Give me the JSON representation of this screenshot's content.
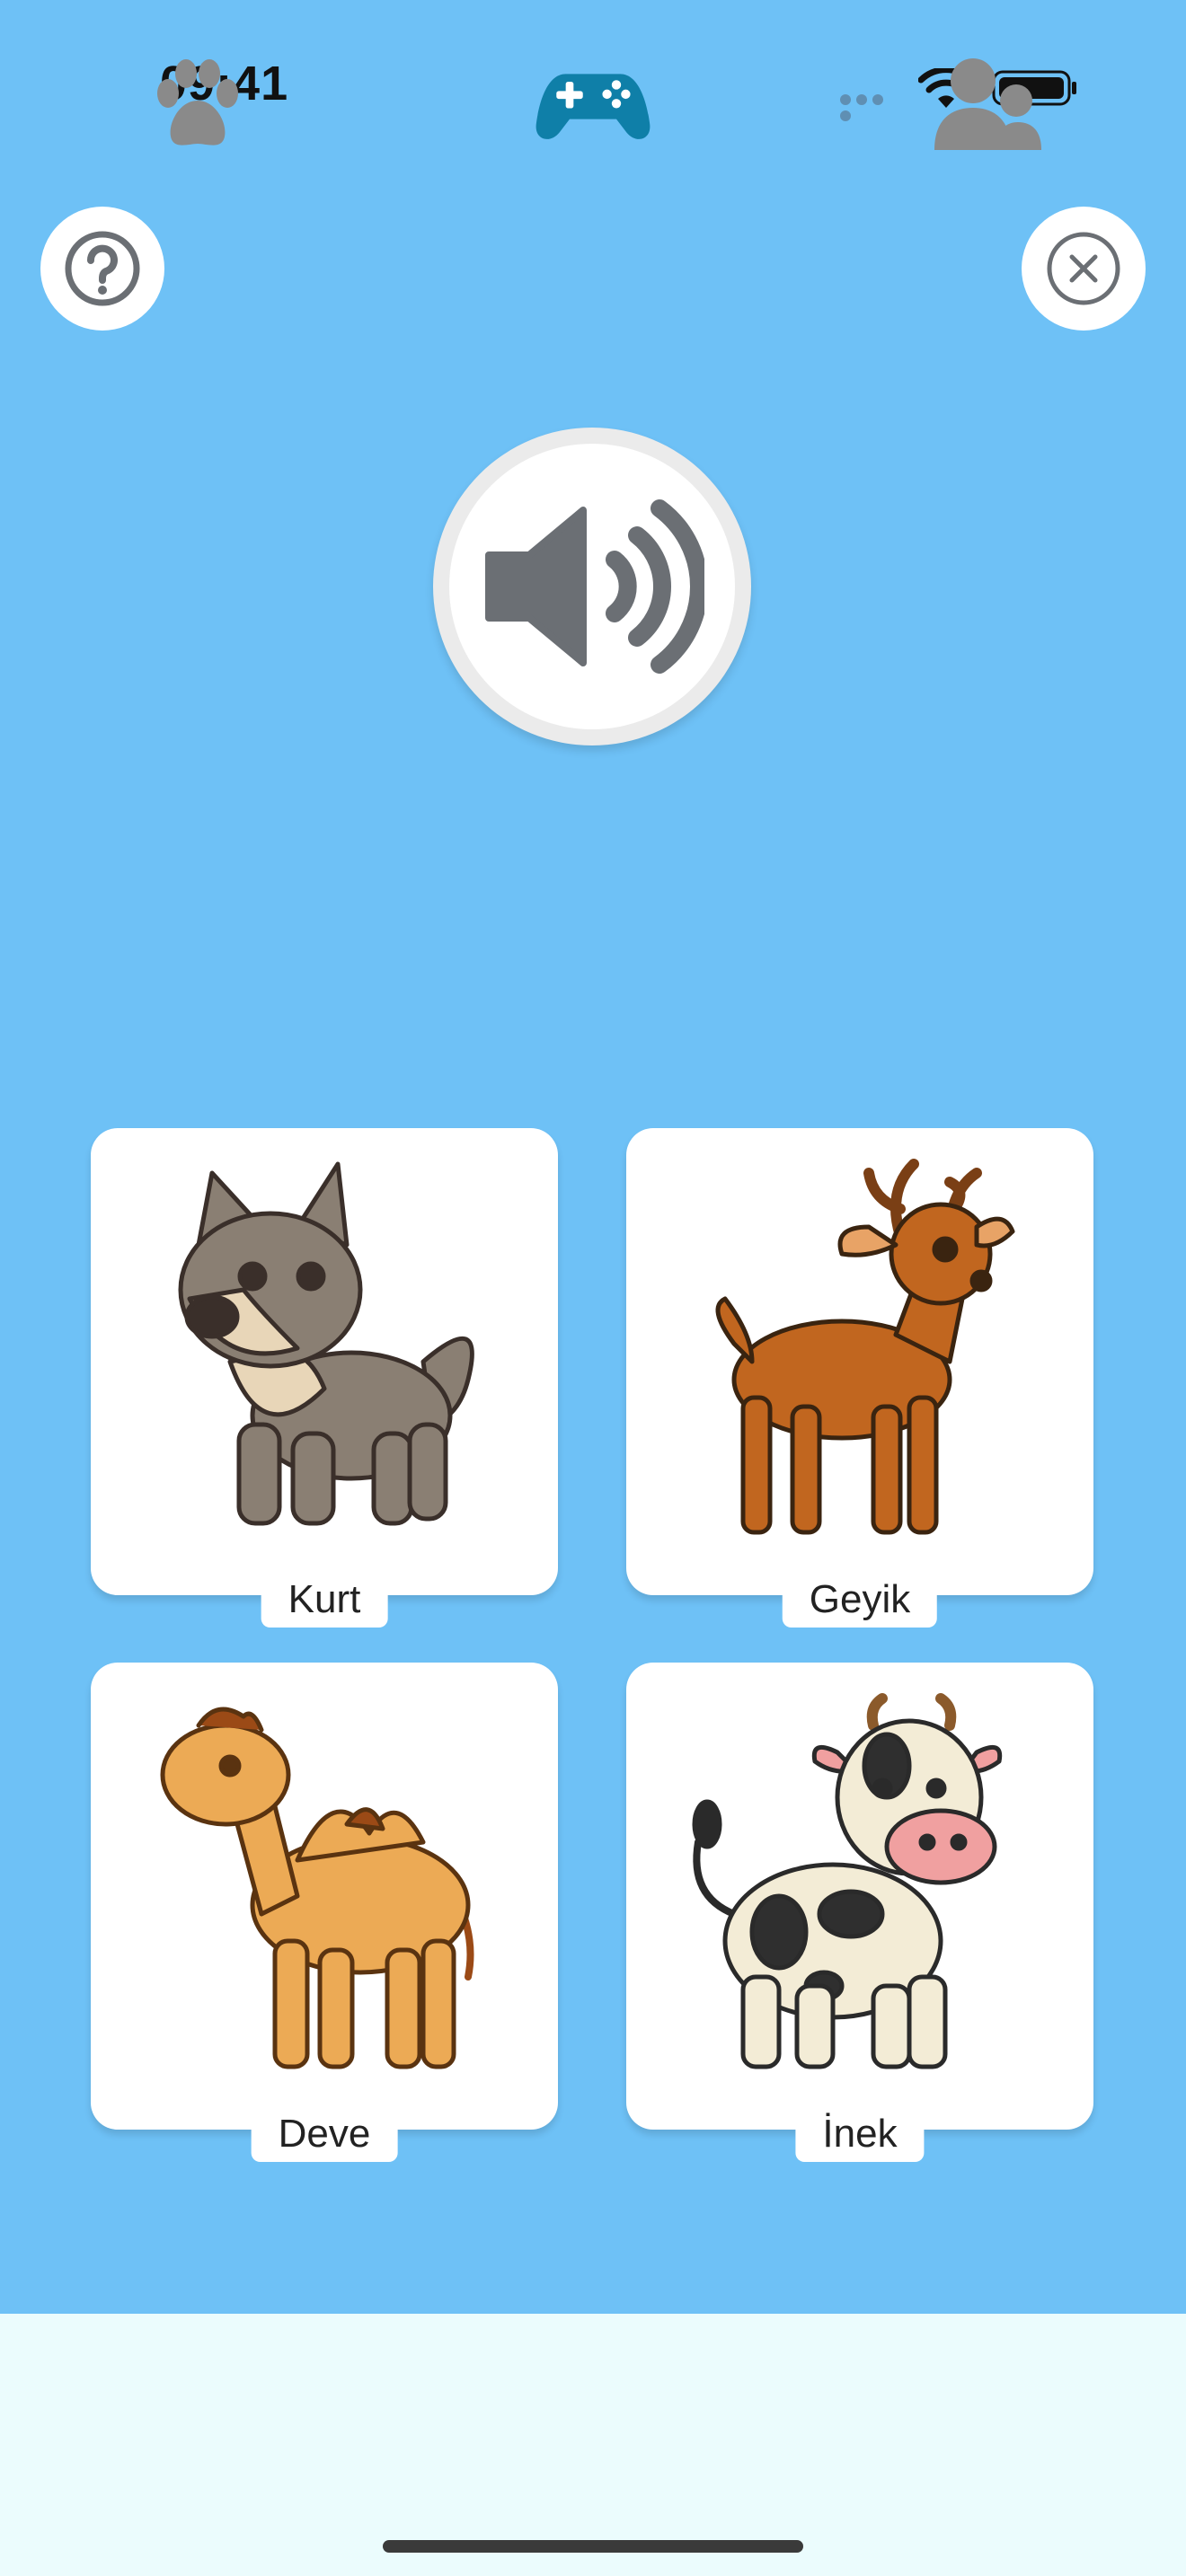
{
  "status_bar": {
    "time": "09:41"
  },
  "header": {
    "help_icon": "question-circle-icon",
    "close_icon": "close-circle-icon"
  },
  "audio": {
    "icon": "speaker-wave-icon"
  },
  "options": [
    {
      "label": "Kurt",
      "image": "wolf-illustration"
    },
    {
      "label": "Geyik",
      "image": "deer-illustration"
    },
    {
      "label": "Deve",
      "image": "camel-illustration"
    },
    {
      "label": "İnek",
      "image": "cow-illustration"
    }
  ],
  "tab_bar": {
    "tabs": [
      {
        "icon": "paw-icon",
        "active": false
      },
      {
        "icon": "gamepad-icon",
        "active": true
      },
      {
        "icon": "profile-users-icon",
        "active": false
      }
    ],
    "active_color": "#0f7fa8",
    "inactive_color": "#8a8a8a"
  },
  "colors": {
    "background": "#6ec1f6",
    "card": "#ffffff",
    "tab_bar": "#ebfcfd"
  }
}
